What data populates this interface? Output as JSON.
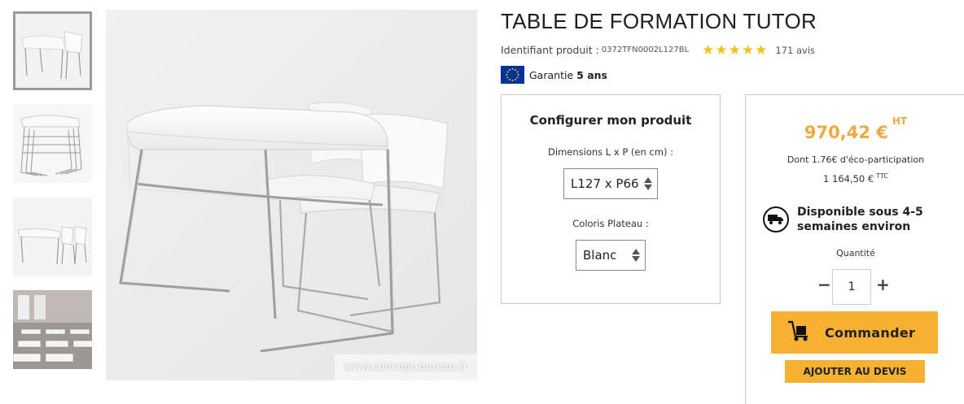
{
  "gallery": {
    "thumbnails": [
      {
        "name": "thumb-table-chairs",
        "active": true
      },
      {
        "name": "thumb-stacked-tables",
        "active": false
      },
      {
        "name": "thumb-table-chairs-side",
        "active": false
      },
      {
        "name": "thumb-classroom",
        "active": false
      }
    ],
    "watermark": "www.concept-bureau.fr"
  },
  "product": {
    "title": "TABLE DE FORMATION TUTOR",
    "id_label": "Identifiant produit :",
    "id_value": "0372TFN0002L127BL",
    "rating": 5,
    "reviews": "171 avis",
    "warranty_label": "Garantie",
    "warranty_value": "5 ans"
  },
  "configurator": {
    "heading": "Configurer mon produit",
    "dimensions_label": "Dimensions L x P (en cm) :",
    "dimensions_value": "L127 x P66",
    "color_label": "Coloris Plateau :",
    "color_value": "Blanc"
  },
  "order": {
    "price_ht": "970,42 €",
    "ht_label": "HT",
    "eco": "Dont 1.76€ d'éco-participation",
    "price_ttc": "1 164,50 €",
    "ttc_label": "TTC",
    "availability": "Disponible sous 4-5 semaines environ",
    "quantity_label": "Quantité",
    "quantity_value": "1",
    "minus": "−",
    "plus": "+",
    "order_button": "Commander",
    "quote_button": "AJOUTER AU DEVIS"
  },
  "colors": {
    "accent": "#f7b130",
    "price": "#f0a93e",
    "star": "#f2c21b",
    "eu_blue": "#003399"
  }
}
